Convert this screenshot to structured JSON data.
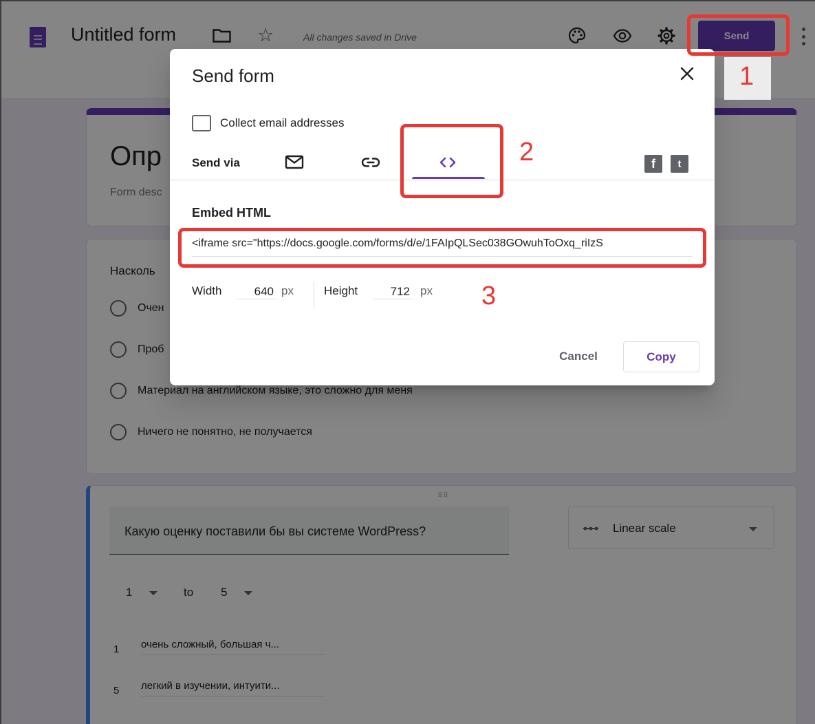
{
  "header": {
    "form_title": "Untitled form",
    "saved_status": "All changes saved in Drive",
    "send_label": "Send",
    "icons": [
      "forms-app-icon",
      "folder-icon",
      "star-icon",
      "palette-icon",
      "preview-eye-icon",
      "settings-gear-icon",
      "more-vert-icon"
    ]
  },
  "form": {
    "title_partial": "Опр",
    "description_partial": "Form desc",
    "question1": {
      "title_partial": "Насколь",
      "options": [
        "Очен",
        "Проб",
        "Материал на английском языке, это сложно для меня",
        "Ничего не понятно, не получается"
      ]
    },
    "question2": {
      "title": "Какую оценку поставили бы вы системе WordPress?",
      "type_label": "Linear scale",
      "scale_from": "1",
      "scale_to_word": "to",
      "scale_to": "5",
      "labels": [
        {
          "num": "1",
          "text": "очень сложный, большая ч..."
        },
        {
          "num": "5",
          "text": "легкий в изучении, интуити..."
        }
      ]
    }
  },
  "dialog": {
    "title": "Send form",
    "collect_email_label": "Collect email addresses",
    "collect_email_checked": false,
    "send_via_label": "Send via",
    "active_tab": "embed-html",
    "embed_heading": "Embed HTML",
    "embed_code": "<iframe src=\"https://docs.google.com/forms/d/e/1FAIpQLSec038GOwuhToOxq_riIzS",
    "width_label": "Width",
    "width_value": "640",
    "height_label": "Height",
    "height_value": "712",
    "unit": "px",
    "cancel_label": "Cancel",
    "copy_label": "Copy",
    "social": [
      "f",
      "t"
    ]
  },
  "annotations": {
    "step1": "1",
    "step2": "2",
    "step3": "3",
    "color": "#e53935"
  },
  "colors": {
    "accent": "#673ab7",
    "question_highlight": "#4285f4"
  }
}
